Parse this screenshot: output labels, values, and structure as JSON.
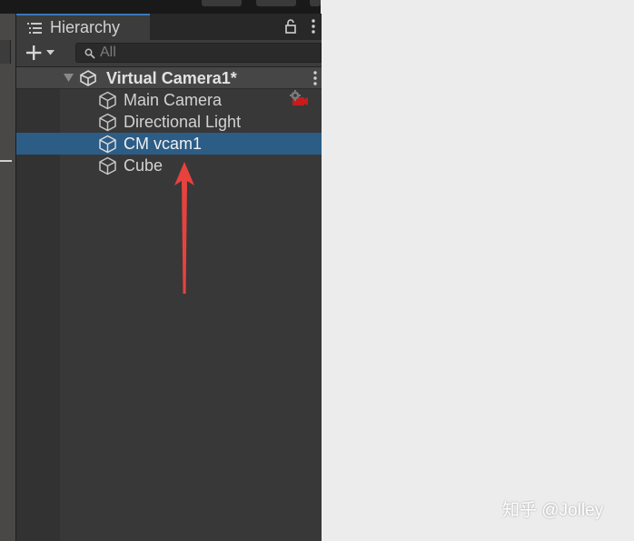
{
  "panel": {
    "tab_title": "Hierarchy",
    "search_placeholder": "All"
  },
  "scene": {
    "name": "Virtual Camera1*"
  },
  "objects": [
    {
      "label": "Main Camera",
      "icon": "cube-icon",
      "selected": false,
      "badge_icon": "camera-gear-icon"
    },
    {
      "label": "Directional Light",
      "icon": "cube-icon",
      "selected": false
    },
    {
      "label": "CM vcam1",
      "icon": "cube-icon",
      "selected": true
    },
    {
      "label": "Cube",
      "icon": "cube-icon",
      "selected": false
    }
  ],
  "colors": {
    "selection": "#2c5d87",
    "tab_accent": "#3a79bb",
    "annotation_arrow": "#e8423f",
    "camera_badge": "#c91b1b"
  },
  "watermark": {
    "text": "知乎 @Jolley"
  }
}
